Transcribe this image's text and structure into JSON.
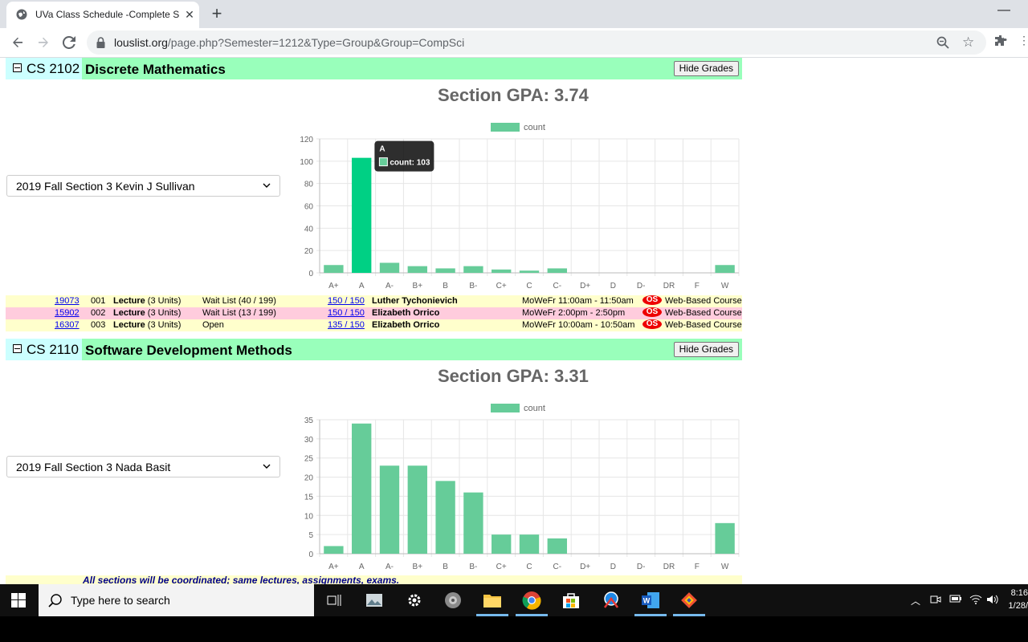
{
  "browser": {
    "tab_title": "UVa Class Schedule -Complete S",
    "url_host": "louslist.org",
    "url_path": "/page.php?Semester=1212&Type=Group&Group=CompSci"
  },
  "courses": [
    {
      "number": "CS 2102",
      "title": "Discrete Mathematics",
      "hide_label": "Hide Grades",
      "gpa_text": "Section GPA: 3.74",
      "selected_section": "2019 Fall Section 3 Kevin J Sullivan",
      "tooltip": {
        "title": "A",
        "body": "count: 103"
      },
      "sections": [
        {
          "id": "19073",
          "num": "001",
          "type": "Lecture",
          "units": "(3 Units)",
          "status": "Wait List (40 / 199)",
          "enroll": "150 / 150",
          "instructor": "Luther Tychonievich",
          "time": "MoWeFr 11:00am - 11:50am",
          "badge": "OS",
          "location": "Web-Based Course"
        },
        {
          "id": "15902",
          "num": "002",
          "type": "Lecture",
          "units": "(3 Units)",
          "status": "Wait List (13 / 199)",
          "enroll": "150 / 150",
          "instructor": "Elizabeth Orrico",
          "time": "MoWeFr 2:00pm - 2:50pm",
          "badge": "OS",
          "location": "Web-Based Course"
        },
        {
          "id": "16307",
          "num": "003",
          "type": "Lecture",
          "units": "(3 Units)",
          "status": "Open",
          "enroll": "135 / 150",
          "instructor": "Elizabeth Orrico",
          "time": "MoWeFr 10:00am - 10:50am",
          "badge": "OS",
          "location": "Web-Based Course"
        }
      ]
    },
    {
      "number": "CS 2110",
      "title": "Software Development Methods",
      "hide_label": "Hide Grades",
      "gpa_text": "Section GPA: 3.31",
      "selected_section": "2019 Fall Section 3 Nada Basit",
      "note": "All sections will be coordinated; same lectures, assignments, exams."
    }
  ],
  "chart_data": [
    {
      "type": "bar",
      "legend": "count",
      "categories": [
        "A+",
        "A",
        "A-",
        "B+",
        "B",
        "B-",
        "C+",
        "C",
        "C-",
        "D+",
        "D",
        "D-",
        "DR",
        "F",
        "W"
      ],
      "series": [
        {
          "name": "count",
          "values": [
            7,
            103,
            9,
            6,
            4,
            6,
            3,
            2,
            4,
            0,
            0,
            0,
            0,
            0,
            7
          ]
        }
      ],
      "yticks": [
        "0",
        "20",
        "40",
        "60",
        "80",
        "100",
        "120"
      ],
      "ylim": [
        0,
        120
      ],
      "highlight_index": 1,
      "bar_color": "#66cc99",
      "highlight_color": "#00d084"
    },
    {
      "type": "bar",
      "legend": "count",
      "categories": [
        "A+",
        "A",
        "A-",
        "B+",
        "B",
        "B-",
        "C+",
        "C",
        "C-",
        "D+",
        "D",
        "D-",
        "DR",
        "F",
        "W"
      ],
      "series": [
        {
          "name": "count",
          "values": [
            2,
            34,
            23,
            23,
            19,
            16,
            5,
            5,
            4,
            0,
            0,
            0,
            0,
            0,
            8
          ]
        }
      ],
      "yticks": [
        "0",
        "5",
        "10",
        "15",
        "20",
        "25",
        "30",
        "35"
      ],
      "ylim": [
        0,
        35
      ],
      "bar_color": "#66cc99"
    }
  ],
  "taskbar": {
    "search_placeholder": "Type here to search",
    "time": "8:16",
    "date": "1/28/"
  }
}
